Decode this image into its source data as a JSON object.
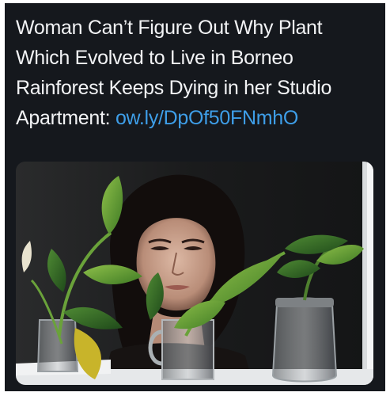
{
  "tweet": {
    "headline": "Woman Can’t Figure Out Why Plant Which Evolved to Live in Borneo Rainforest Keeps Dying in her Studio Apartment:",
    "link_text": "ow.ly/DpOf50FNmhO",
    "link_color": "#3e9ee8"
  },
  "photo": {
    "subject_icon": "photo-woman-with-plants-icon"
  }
}
